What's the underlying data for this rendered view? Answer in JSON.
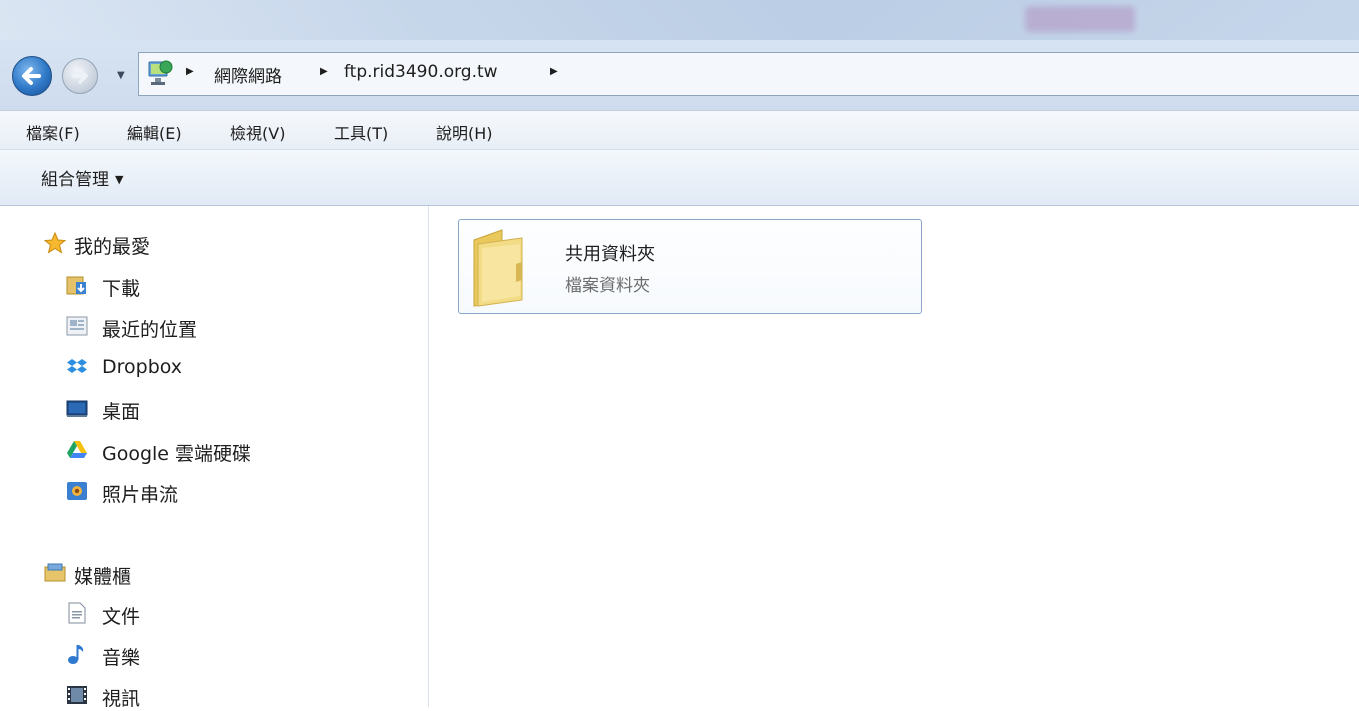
{
  "address": {
    "crumbs": [
      "網際網路",
      "ftp.rid3490.org.tw"
    ]
  },
  "menu": [
    "檔案(F)",
    "編輯(E)",
    "檢視(V)",
    "工具(T)",
    "說明(H)"
  ],
  "commandbar": {
    "organize": "組合管理"
  },
  "navigation": {
    "favorites_header": "我的最愛",
    "favorites": [
      "下載",
      "最近的位置",
      "Dropbox",
      "桌面",
      "Google 雲端硬碟",
      "照片串流"
    ],
    "libraries_header": "媒體櫃",
    "libraries": [
      "文件",
      "音樂",
      "視訊"
    ]
  },
  "content": {
    "items": [
      {
        "name": "共用資料夾",
        "type": "檔案資料夾",
        "icon": "folder-icon"
      }
    ]
  },
  "colors": {
    "accent": "#2e78c7",
    "tile_border": "#8aa7c8",
    "secondary_text": "#6d6d6d"
  }
}
